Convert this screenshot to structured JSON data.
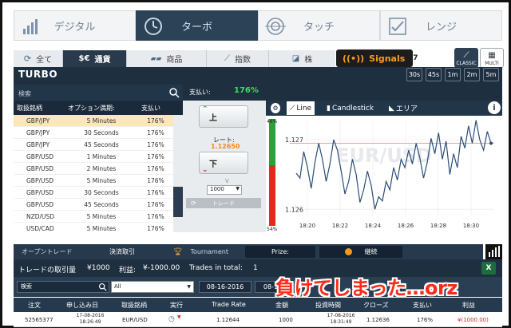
{
  "mode_tabs": [
    {
      "label": "デジタル",
      "icon": "bar-chart-icon"
    },
    {
      "label": "ターボ",
      "icon": "clock-icon",
      "active": true
    },
    {
      "label": "タッチ",
      "icon": "target-icon"
    },
    {
      "label": "レンジ",
      "icon": "range-icon"
    }
  ],
  "asset_tabs": [
    {
      "label": "全て",
      "icon": "refresh-icon"
    },
    {
      "label": "通貨",
      "icon": "currency-icon",
      "active": true
    },
    {
      "label": "商品",
      "icon": "gold-bars-icon"
    },
    {
      "label": "指数",
      "icon": "line-chart-icon"
    },
    {
      "label": "株",
      "icon": "stock-icon"
    }
  ],
  "signals": {
    "label": "Signals",
    "count": "7"
  },
  "view_buttons": {
    "classic": "CLASSIC",
    "multi": "MULTI"
  },
  "panel": {
    "title": "TURBO",
    "timeframes": [
      "30s",
      "45s",
      "1m",
      "2m",
      "5m"
    ],
    "search_placeholder": "検索",
    "payout_label": "支払い:",
    "payout_value": "176%"
  },
  "asset_table": {
    "headers": [
      "取扱銘柄",
      "オプション満期:",
      "支払い"
    ],
    "rows": [
      {
        "asset": "GBP/JPY",
        "expiry": "5 Minutes",
        "payout": "176%",
        "selected": true
      },
      {
        "asset": "GBP/JPY",
        "expiry": "30 Seconds",
        "payout": "176%"
      },
      {
        "asset": "GBP/JPY",
        "expiry": "45 Seconds",
        "payout": "176%"
      },
      {
        "asset": "GBP/USD",
        "expiry": "1 Minutes",
        "payout": "176%"
      },
      {
        "asset": "GBP/USD",
        "expiry": "2 Minutes",
        "payout": "176%"
      },
      {
        "asset": "GBP/USD",
        "expiry": "5 Minutes",
        "payout": "176%"
      },
      {
        "asset": "GBP/USD",
        "expiry": "30 Seconds",
        "payout": "176%"
      },
      {
        "asset": "GBP/USD",
        "expiry": "45 Seconds",
        "payout": "176%"
      },
      {
        "asset": "NZD/USD",
        "expiry": "5 Minutes",
        "payout": "176%"
      },
      {
        "asset": "USD/CAD",
        "expiry": "5 Minutes",
        "payout": "176%"
      }
    ]
  },
  "trade": {
    "high_label": "上",
    "rate_label": "レート:",
    "rate_value": "1.12650",
    "low_label": "下",
    "v_label": "V",
    "amount": "1000",
    "trade_button": "トレード"
  },
  "chart_tabs": {
    "line": "Line",
    "candlestick": "Candlestick",
    "area": "エリア",
    "info": "i"
  },
  "chart_data": {
    "type": "line",
    "watermark": "EUR/USD",
    "x": [
      "18:20",
      "18:22",
      "18:24",
      "18:26",
      "18:28",
      "18:30"
    ],
    "y_ticks": [
      "1.127",
      "1.126"
    ],
    "ylim": [
      1.1259,
      1.1273
    ],
    "sentiment": {
      "up": "46%",
      "down": "54%"
    },
    "series": [
      {
        "values": [
          1.12652,
          1.12645,
          1.12683,
          1.1266,
          1.1263,
          1.12668,
          1.12695,
          1.12672,
          1.1264,
          1.12665,
          1.127,
          1.12685,
          1.12655,
          1.12622,
          1.1264,
          1.12672,
          1.1265,
          1.1261,
          1.12628,
          1.12655,
          1.12635,
          1.126,
          1.12618,
          1.12612,
          1.1264,
          1.12628,
          1.1266,
          1.12642,
          1.12672,
          1.1266,
          1.12685,
          1.12665,
          1.12695,
          1.12674,
          1.12645,
          1.12668,
          1.12702,
          1.1268,
          1.1271,
          1.12672,
          1.12698,
          1.1265,
          1.1268,
          1.1266,
          1.12705,
          1.12688,
          1.1272,
          1.12695,
          1.12728,
          1.127,
          1.12685,
          1.12712,
          1.12695
        ]
      }
    ],
    "strike_line": 1.12695
  },
  "bottom_tabs": {
    "open_trades": "オープントレード",
    "closed_trades": "決済取引",
    "tournament": "Tournament",
    "prize": "Prize:",
    "continue": "継続"
  },
  "summary": {
    "volume_label": "トレードの取引量",
    "volume_value": "¥1000",
    "profit_label": "利益:",
    "profit_value": "¥-1000.00",
    "total_label": "Trades in total:",
    "total_value": "1"
  },
  "filters": {
    "search_placeholder": "検索",
    "select_value": "All",
    "date_from": "08-16-2016",
    "date_to": "08-1"
  },
  "overlay_caption": "負けてしまった…orz",
  "trade_table": {
    "headers": [
      "注文",
      "申し込み日",
      "取扱銘柄",
      "実行",
      "Trade Rate",
      "金額",
      "投資時間",
      "クローズ",
      "支払い",
      "利益"
    ],
    "row": {
      "id": "52565377",
      "date": "17-08-2016 18:26:49",
      "asset": "EUR/USD",
      "rate": "1.12644",
      "amount": "1000",
      "time": "17-08-2016 18:31:49",
      "close": "1.12636",
      "payout": "176%",
      "profit": "¥(1000.00)"
    }
  },
  "colors": {
    "accent_green": "#35e060",
    "accent_orange": "#f08a19",
    "loss_red": "#d62b20",
    "panel_dark": "#1e2f40"
  }
}
